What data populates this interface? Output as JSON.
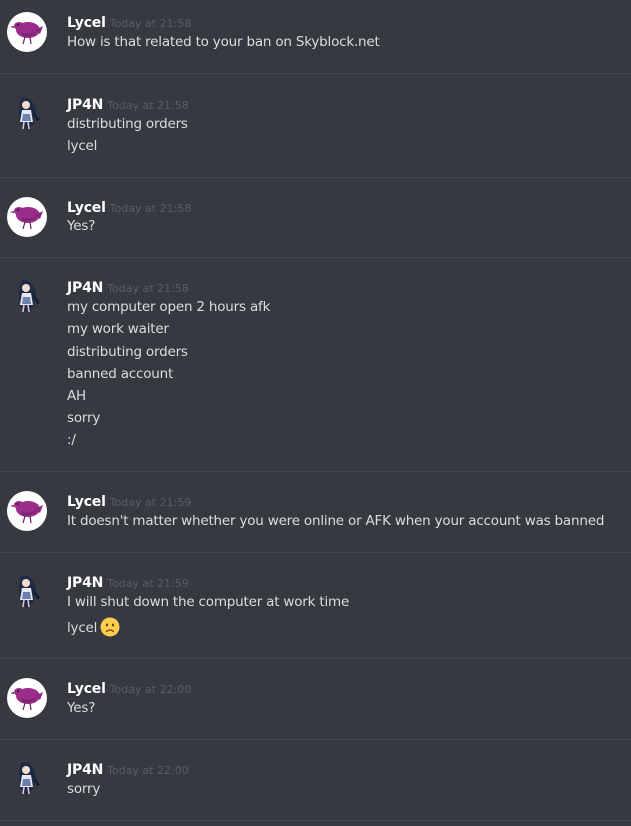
{
  "messages": [
    {
      "author": "Lycel",
      "time": "Today at 21:58",
      "lines": [
        "How is that related to your ban on Skyblock.net"
      ]
    },
    {
      "author": "JP4N",
      "time": "Today at 21:58",
      "lines": [
        "distributing orders",
        "lycel"
      ]
    },
    {
      "author": "Lycel",
      "time": "Today at 21:58",
      "lines": [
        "Yes?"
      ]
    },
    {
      "author": "JP4N",
      "time": "Today at 21:58",
      "lines": [
        "my computer open 2 hours afk",
        "my work waiter",
        "distributing orders",
        "banned account",
        "AH",
        "sorry",
        ":/"
      ]
    },
    {
      "author": "Lycel",
      "time": "Today at 21:59",
      "lines": [
        "It doesn't matter whether you were online or AFK when your account was banned"
      ]
    },
    {
      "author": "JP4N",
      "time": "Today at 21:59",
      "lines": [
        "I will shut down the computer at work time",
        "lycel"
      ],
      "emoji": "slightly-frowning-face"
    },
    {
      "author": "Lycel",
      "time": "Today at 22:00",
      "lines": [
        "Yes?"
      ]
    },
    {
      "author": "JP4N",
      "time": "Today at 22:00",
      "lines": [
        "sorry"
      ]
    }
  ],
  "colors": {
    "background": "#36393f",
    "divider": "#42454a",
    "username": "#ffffff",
    "timestamp": "#5a5d63",
    "text": "#dcddde",
    "lycel_avatar_bird": "#9b2d8a"
  }
}
